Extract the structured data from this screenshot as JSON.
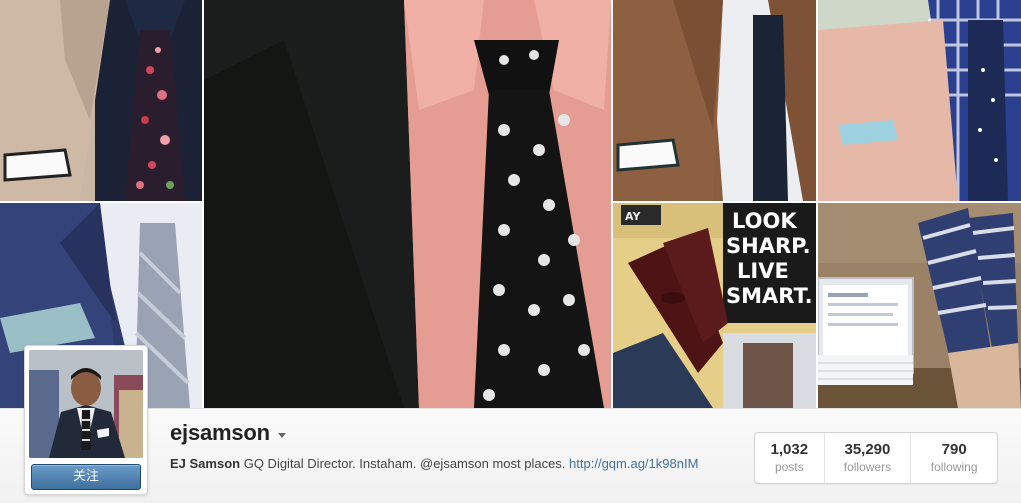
{
  "profile": {
    "username": "ejsamson",
    "full_name": "EJ Samson",
    "bio_text": "GQ Digital Director. Instaham. @ejsamson most places.",
    "bio_link": "http://gqm.ag/1k98nIM",
    "follow_label": "关注"
  },
  "stats": [
    {
      "value": "1,032",
      "label": "posts"
    },
    {
      "value": "35,290",
      "label": "followers"
    },
    {
      "value": "790",
      "label": "following"
    }
  ],
  "photos": {
    "book_text": [
      "LOOK",
      "SHARP.",
      "LIVE",
      "SMART."
    ],
    "bag_tag": "AY"
  },
  "colors": {
    "link": "#3f729b",
    "follow_button": "#4f7fad"
  }
}
